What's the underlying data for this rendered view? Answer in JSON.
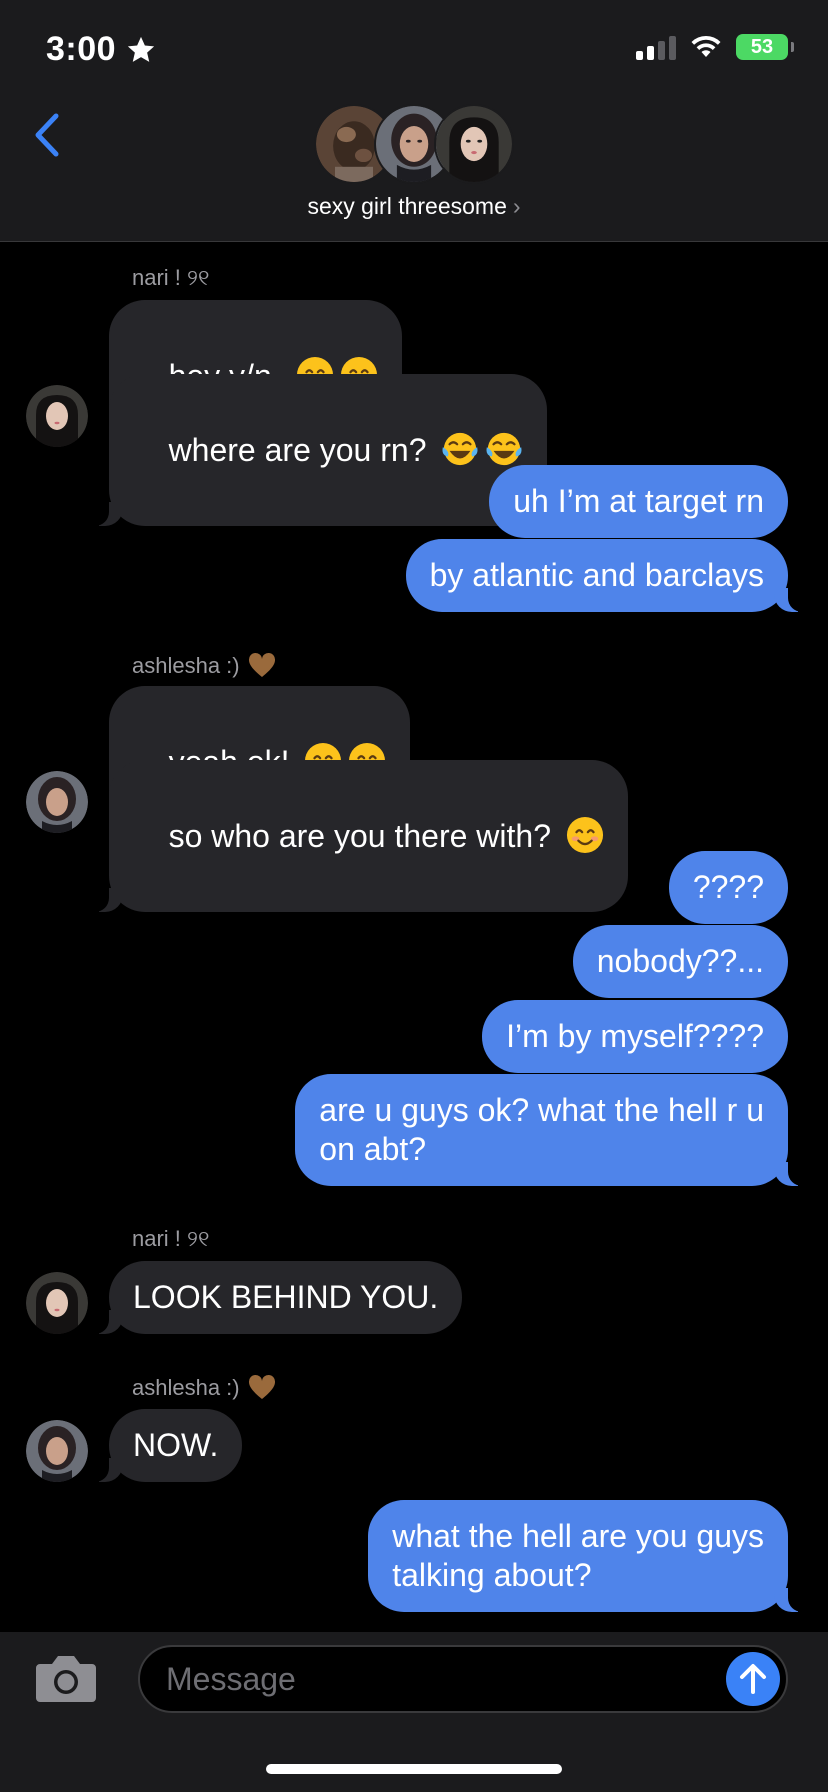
{
  "status_bar": {
    "time": "3:00",
    "battery": "53"
  },
  "header": {
    "group_name": "sexy girl threesome",
    "chevron": "›"
  },
  "messages": [
    {
      "sender": "nari ! ୨୧"
    },
    {
      "text": "hey y/n.."
    },
    {
      "text": "where are you rn?"
    },
    {
      "text": "uh I’m at target rn"
    },
    {
      "text": "by atlantic and barclays"
    },
    {
      "sender": "ashlesha :)"
    },
    {
      "text": "yeah ok!"
    },
    {
      "text": "so who are you there with?"
    },
    {
      "text": "????"
    },
    {
      "text": "nobody??..."
    },
    {
      "text": "I’m by myself????"
    },
    {
      "text": "are u guys ok? what the hell r u\non abt?"
    },
    {
      "sender": "nari ! ୨୧"
    },
    {
      "text": "LOOK BEHIND YOU."
    },
    {
      "sender": "ashlesha :)"
    },
    {
      "text": "NOW."
    },
    {
      "text": "what the hell are you guys\ntalking about?"
    }
  ],
  "composer": {
    "placeholder": "Message"
  },
  "colors": {
    "outgoing": "#4f84ea",
    "incoming": "#26262a",
    "send_button": "#3a82f7",
    "battery": "#4cd964"
  }
}
